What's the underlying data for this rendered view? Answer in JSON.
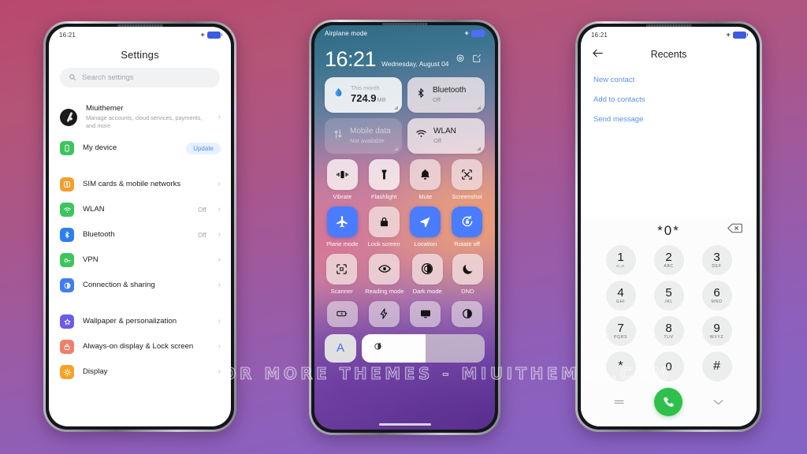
{
  "watermark": "VISIT  FOR  MORE  THEMES  -  MIUITHEMER.COM",
  "colors": {
    "accent_blue": "#4a7cff",
    "link_blue": "#5a90e8",
    "call_green": "#2ec04a",
    "battery_blue": "#3b5ce0",
    "background_top": "#b9486e",
    "background_bottom": "#8463c6"
  },
  "left_phone": {
    "statusbar": {
      "time": "16:21",
      "charging_icon": "+",
      "battery_icon": "battery-full"
    },
    "title": "Settings",
    "search": {
      "placeholder": "Search settings",
      "icon": "search-icon"
    },
    "account": {
      "name": "Miuithemer",
      "subtitle": "Manage accounts, cloud services, payments, and more",
      "chevron": "›"
    },
    "device": {
      "label": "My device",
      "badge": "Update",
      "icon": "phone-icon"
    },
    "items": [
      {
        "label": "SIM cards & mobile networks",
        "value": "",
        "icon": "sim-card-icon",
        "color": "#f0a030",
        "chevron": "›"
      },
      {
        "label": "WLAN",
        "value": "Off",
        "icon": "wifi-icon",
        "color": "#3ec45e",
        "chevron": "›"
      },
      {
        "label": "Bluetooth",
        "value": "Off",
        "icon": "bluetooth-icon",
        "color": "#2f7ef0",
        "chevron": "›"
      },
      {
        "label": "VPN",
        "value": "",
        "icon": "key-icon",
        "color": "#3ec45e",
        "chevron": "›"
      },
      {
        "label": "Connection & sharing",
        "value": "",
        "icon": "connection-icon",
        "color": "#3f7ef0",
        "chevron": "›"
      }
    ],
    "items2": [
      {
        "label": "Wallpaper & personalization",
        "value": "",
        "icon": "star-icon",
        "color": "#6b5ce7",
        "chevron": "›"
      },
      {
        "label": "Always-on display & Lock screen",
        "value": "",
        "icon": "lock-icon",
        "color": "#ef7f6a",
        "chevron": "›"
      },
      {
        "label": "Display",
        "value": "",
        "icon": "brightness-icon",
        "color": "#f3a327",
        "chevron": "›"
      }
    ]
  },
  "center_phone": {
    "statusbar": {
      "left": "Airplane mode",
      "charging_icon": "+",
      "battery_icon": "battery-full"
    },
    "clock": {
      "time": "16:21",
      "date": "Wednesday, August 04"
    },
    "header_icons": [
      "settings-gear-icon",
      "edit-icon"
    ],
    "cards": [
      {
        "type": "data-usage",
        "icon": "data-drop-icon",
        "top_label": "This month",
        "main_value": "724.9",
        "unit": "MB",
        "state": "active"
      },
      {
        "type": "bluetooth",
        "icon": "bluetooth-icon",
        "name": "Bluetooth",
        "status": "Off",
        "state": "frost"
      },
      {
        "type": "mobile-data",
        "icon": "mobile-data-icon",
        "name": "Mobile data",
        "status": "Not available",
        "state": "dim"
      },
      {
        "type": "wlan",
        "icon": "wifi-icon",
        "name": "WLAN",
        "status": "Off",
        "state": "frost"
      }
    ],
    "toggles_row1": [
      {
        "label": "Vibrate",
        "icon": "vibrate-icon",
        "on": false
      },
      {
        "label": "Flashlight",
        "icon": "flashlight-icon",
        "on": false
      },
      {
        "label": "Mute",
        "icon": "bell-icon",
        "on": false
      },
      {
        "label": "Screenshot",
        "icon": "screenshot-icon",
        "on": false
      }
    ],
    "toggles_row2": [
      {
        "label": "Plane mode",
        "icon": "airplane-icon",
        "on": true
      },
      {
        "label": "Lock screen",
        "icon": "lock-icon",
        "on": false
      },
      {
        "label": "Location",
        "icon": "location-arrow-icon",
        "on": true
      },
      {
        "label": "Rotate off",
        "icon": "rotate-lock-icon",
        "on": true
      }
    ],
    "toggles_row3": [
      {
        "label": "Scanner",
        "icon": "scan-icon",
        "on": false
      },
      {
        "label": "Reading mode",
        "icon": "eye-icon",
        "on": false
      },
      {
        "label": "Dark mode",
        "icon": "contrast-icon",
        "on": false
      },
      {
        "label": "DND",
        "icon": "moon-icon",
        "on": false
      }
    ],
    "toggles_row4": [
      {
        "icon": "battery-saver-icon"
      },
      {
        "icon": "lightning-icon"
      },
      {
        "icon": "cast-screen-icon"
      },
      {
        "icon": "half-contrast-icon"
      }
    ],
    "bottom": {
      "left_icon": "font-size-A-icon",
      "slider_icon": "brightness-auto-icon"
    }
  },
  "right_phone": {
    "statusbar": {
      "time": "16:21",
      "charging_icon": "+",
      "battery_icon": "battery-full"
    },
    "header": {
      "back_icon": "back-arrow-icon",
      "title": "Recents"
    },
    "links": [
      "New contact",
      "Add to contacts",
      "Send message"
    ],
    "dialer": {
      "entered_number": "*0*",
      "delete_icon": "backspace-icon",
      "keys": [
        {
          "main": "1",
          "sub": "∞,∞"
        },
        {
          "main": "2",
          "sub": "ABC"
        },
        {
          "main": "3",
          "sub": "DEF"
        },
        {
          "main": "4",
          "sub": "GHI"
        },
        {
          "main": "5",
          "sub": "JKL"
        },
        {
          "main": "6",
          "sub": "MNO"
        },
        {
          "main": "7",
          "sub": "PQRS"
        },
        {
          "main": "8",
          "sub": "TUV"
        },
        {
          "main": "9",
          "sub": "WXYZ"
        },
        {
          "main": "*",
          "sub": ""
        },
        {
          "main": "0",
          "sub": ""
        },
        {
          "main": "#",
          "sub": ""
        }
      ],
      "actions": {
        "left_icon": "menu-lines-icon",
        "call_icon": "phone-call-icon",
        "right_icon": "chevron-down-icon"
      }
    }
  }
}
